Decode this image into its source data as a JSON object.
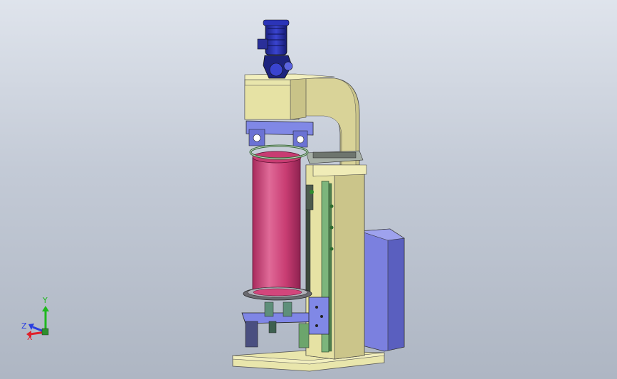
{
  "triad": {
    "y_label": "Y",
    "x_label": "X",
    "z_label": "Z",
    "colors": {
      "x": "#e0202a",
      "y": "#1fb81f",
      "z": "#2a3ee0"
    }
  },
  "palette": {
    "frame": "#e6e2a4",
    "frame_shadow": "#b9b27a",
    "cylinder": "#d3467c",
    "blue_parts": "#7f86e6",
    "motor": "#2b34b8",
    "cabinet": "#7b80df",
    "rail": "#6ca56c"
  }
}
